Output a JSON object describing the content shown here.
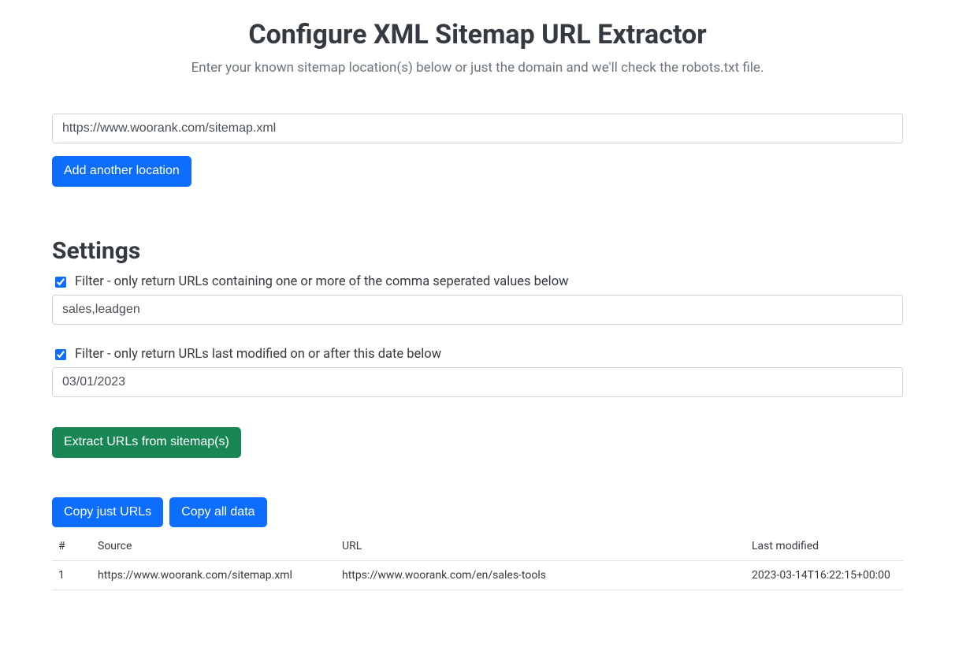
{
  "header": {
    "title": "Configure XML Sitemap URL Extractor",
    "subtitle": "Enter your known sitemap location(s) below or just the domain and we'll check the robots.txt file."
  },
  "location": {
    "input_value": "https://www.woorank.com/sitemap.xml",
    "add_button_label": "Add another location"
  },
  "settings": {
    "heading": "Settings",
    "filter_contains": {
      "checked": true,
      "label": "Filter - only return URLs containing one or more of the comma seperated values below",
      "value": "sales,leadgen"
    },
    "filter_date": {
      "checked": true,
      "label": "Filter - only return URLs last modified on or after this date below",
      "value": "03/01/2023"
    }
  },
  "actions": {
    "extract_label": "Extract URLs from sitemap(s)",
    "copy_urls_label": "Copy just URLs",
    "copy_all_label": "Copy all data"
  },
  "results": {
    "columns": {
      "num": "#",
      "source": "Source",
      "url": "URL",
      "modified": "Last modified"
    },
    "rows": [
      {
        "num": "1",
        "source": "https://www.woorank.com/sitemap.xml",
        "url": "https://www.woorank.com/en/sales-tools",
        "modified": "2023-03-14T16:22:15+00:00"
      }
    ]
  }
}
